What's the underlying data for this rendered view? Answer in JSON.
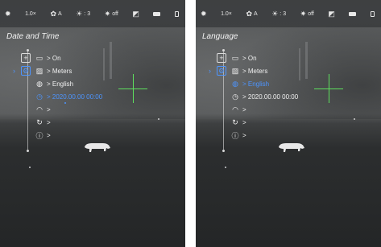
{
  "screens": [
    {
      "title": "Date and Time",
      "status": {
        "brightness_icon": "sun-icon",
        "zoom": "1.0×",
        "mode_label": "A",
        "contrast_value": "3",
        "ir_label": "off"
      },
      "menu": [
        {
          "icon": "display-icon",
          "label": "> On"
        },
        {
          "icon": "image-icon",
          "label": "> Meters"
        },
        {
          "icon": "globe-icon",
          "label": "> English"
        },
        {
          "icon": "clock-icon",
          "label": "> 2020.00.00   00:00",
          "active": true
        },
        {
          "icon": "wifi-icon",
          "label": ">"
        },
        {
          "icon": "reset-icon",
          "label": ">"
        },
        {
          "icon": "info-icon",
          "label": ">"
        }
      ]
    },
    {
      "title": "Language",
      "status": {
        "brightness_icon": "sun-icon",
        "zoom": "1.0×",
        "mode_label": "A",
        "contrast_value": "3",
        "ir_label": "off"
      },
      "menu": [
        {
          "icon": "display-icon",
          "label": "> On"
        },
        {
          "icon": "image-icon",
          "label": "> Meters"
        },
        {
          "icon": "globe-icon",
          "label": "> English",
          "active": true
        },
        {
          "icon": "clock-icon",
          "label": "> 2020.00.00   00:00"
        },
        {
          "icon": "wifi-icon",
          "label": ">"
        },
        {
          "icon": "reset-icon",
          "label": ">"
        },
        {
          "icon": "info-icon",
          "label": ">"
        }
      ]
    }
  ],
  "colors": {
    "accent": "#4d95ff",
    "reticle": "#5ee05e"
  }
}
